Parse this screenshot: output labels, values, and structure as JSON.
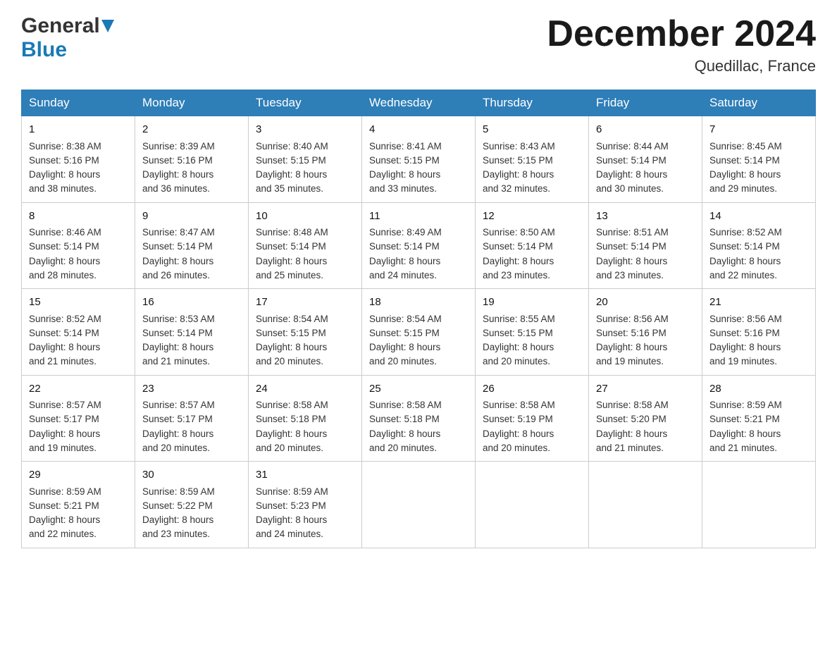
{
  "header": {
    "logo_general": "General",
    "logo_blue": "Blue",
    "month_title": "December 2024",
    "location": "Quedillac, France"
  },
  "days_of_week": [
    "Sunday",
    "Monday",
    "Tuesday",
    "Wednesday",
    "Thursday",
    "Friday",
    "Saturday"
  ],
  "weeks": [
    [
      {
        "date": "1",
        "sunrise": "Sunrise: 8:38 AM",
        "sunset": "Sunset: 5:16 PM",
        "daylight": "Daylight: 8 hours",
        "daylight2": "and 38 minutes."
      },
      {
        "date": "2",
        "sunrise": "Sunrise: 8:39 AM",
        "sunset": "Sunset: 5:16 PM",
        "daylight": "Daylight: 8 hours",
        "daylight2": "and 36 minutes."
      },
      {
        "date": "3",
        "sunrise": "Sunrise: 8:40 AM",
        "sunset": "Sunset: 5:15 PM",
        "daylight": "Daylight: 8 hours",
        "daylight2": "and 35 minutes."
      },
      {
        "date": "4",
        "sunrise": "Sunrise: 8:41 AM",
        "sunset": "Sunset: 5:15 PM",
        "daylight": "Daylight: 8 hours",
        "daylight2": "and 33 minutes."
      },
      {
        "date": "5",
        "sunrise": "Sunrise: 8:43 AM",
        "sunset": "Sunset: 5:15 PM",
        "daylight": "Daylight: 8 hours",
        "daylight2": "and 32 minutes."
      },
      {
        "date": "6",
        "sunrise": "Sunrise: 8:44 AM",
        "sunset": "Sunset: 5:14 PM",
        "daylight": "Daylight: 8 hours",
        "daylight2": "and 30 minutes."
      },
      {
        "date": "7",
        "sunrise": "Sunrise: 8:45 AM",
        "sunset": "Sunset: 5:14 PM",
        "daylight": "Daylight: 8 hours",
        "daylight2": "and 29 minutes."
      }
    ],
    [
      {
        "date": "8",
        "sunrise": "Sunrise: 8:46 AM",
        "sunset": "Sunset: 5:14 PM",
        "daylight": "Daylight: 8 hours",
        "daylight2": "and 28 minutes."
      },
      {
        "date": "9",
        "sunrise": "Sunrise: 8:47 AM",
        "sunset": "Sunset: 5:14 PM",
        "daylight": "Daylight: 8 hours",
        "daylight2": "and 26 minutes."
      },
      {
        "date": "10",
        "sunrise": "Sunrise: 8:48 AM",
        "sunset": "Sunset: 5:14 PM",
        "daylight": "Daylight: 8 hours",
        "daylight2": "and 25 minutes."
      },
      {
        "date": "11",
        "sunrise": "Sunrise: 8:49 AM",
        "sunset": "Sunset: 5:14 PM",
        "daylight": "Daylight: 8 hours",
        "daylight2": "and 24 minutes."
      },
      {
        "date": "12",
        "sunrise": "Sunrise: 8:50 AM",
        "sunset": "Sunset: 5:14 PM",
        "daylight": "Daylight: 8 hours",
        "daylight2": "and 23 minutes."
      },
      {
        "date": "13",
        "sunrise": "Sunrise: 8:51 AM",
        "sunset": "Sunset: 5:14 PM",
        "daylight": "Daylight: 8 hours",
        "daylight2": "and 23 minutes."
      },
      {
        "date": "14",
        "sunrise": "Sunrise: 8:52 AM",
        "sunset": "Sunset: 5:14 PM",
        "daylight": "Daylight: 8 hours",
        "daylight2": "and 22 minutes."
      }
    ],
    [
      {
        "date": "15",
        "sunrise": "Sunrise: 8:52 AM",
        "sunset": "Sunset: 5:14 PM",
        "daylight": "Daylight: 8 hours",
        "daylight2": "and 21 minutes."
      },
      {
        "date": "16",
        "sunrise": "Sunrise: 8:53 AM",
        "sunset": "Sunset: 5:14 PM",
        "daylight": "Daylight: 8 hours",
        "daylight2": "and 21 minutes."
      },
      {
        "date": "17",
        "sunrise": "Sunrise: 8:54 AM",
        "sunset": "Sunset: 5:15 PM",
        "daylight": "Daylight: 8 hours",
        "daylight2": "and 20 minutes."
      },
      {
        "date": "18",
        "sunrise": "Sunrise: 8:54 AM",
        "sunset": "Sunset: 5:15 PM",
        "daylight": "Daylight: 8 hours",
        "daylight2": "and 20 minutes."
      },
      {
        "date": "19",
        "sunrise": "Sunrise: 8:55 AM",
        "sunset": "Sunset: 5:15 PM",
        "daylight": "Daylight: 8 hours",
        "daylight2": "and 20 minutes."
      },
      {
        "date": "20",
        "sunrise": "Sunrise: 8:56 AM",
        "sunset": "Sunset: 5:16 PM",
        "daylight": "Daylight: 8 hours",
        "daylight2": "and 19 minutes."
      },
      {
        "date": "21",
        "sunrise": "Sunrise: 8:56 AM",
        "sunset": "Sunset: 5:16 PM",
        "daylight": "Daylight: 8 hours",
        "daylight2": "and 19 minutes."
      }
    ],
    [
      {
        "date": "22",
        "sunrise": "Sunrise: 8:57 AM",
        "sunset": "Sunset: 5:17 PM",
        "daylight": "Daylight: 8 hours",
        "daylight2": "and 19 minutes."
      },
      {
        "date": "23",
        "sunrise": "Sunrise: 8:57 AM",
        "sunset": "Sunset: 5:17 PM",
        "daylight": "Daylight: 8 hours",
        "daylight2": "and 20 minutes."
      },
      {
        "date": "24",
        "sunrise": "Sunrise: 8:58 AM",
        "sunset": "Sunset: 5:18 PM",
        "daylight": "Daylight: 8 hours",
        "daylight2": "and 20 minutes."
      },
      {
        "date": "25",
        "sunrise": "Sunrise: 8:58 AM",
        "sunset": "Sunset: 5:18 PM",
        "daylight": "Daylight: 8 hours",
        "daylight2": "and 20 minutes."
      },
      {
        "date": "26",
        "sunrise": "Sunrise: 8:58 AM",
        "sunset": "Sunset: 5:19 PM",
        "daylight": "Daylight: 8 hours",
        "daylight2": "and 20 minutes."
      },
      {
        "date": "27",
        "sunrise": "Sunrise: 8:58 AM",
        "sunset": "Sunset: 5:20 PM",
        "daylight": "Daylight: 8 hours",
        "daylight2": "and 21 minutes."
      },
      {
        "date": "28",
        "sunrise": "Sunrise: 8:59 AM",
        "sunset": "Sunset: 5:21 PM",
        "daylight": "Daylight: 8 hours",
        "daylight2": "and 21 minutes."
      }
    ],
    [
      {
        "date": "29",
        "sunrise": "Sunrise: 8:59 AM",
        "sunset": "Sunset: 5:21 PM",
        "daylight": "Daylight: 8 hours",
        "daylight2": "and 22 minutes."
      },
      {
        "date": "30",
        "sunrise": "Sunrise: 8:59 AM",
        "sunset": "Sunset: 5:22 PM",
        "daylight": "Daylight: 8 hours",
        "daylight2": "and 23 minutes."
      },
      {
        "date": "31",
        "sunrise": "Sunrise: 8:59 AM",
        "sunset": "Sunset: 5:23 PM",
        "daylight": "Daylight: 8 hours",
        "daylight2": "and 24 minutes."
      },
      null,
      null,
      null,
      null
    ]
  ]
}
